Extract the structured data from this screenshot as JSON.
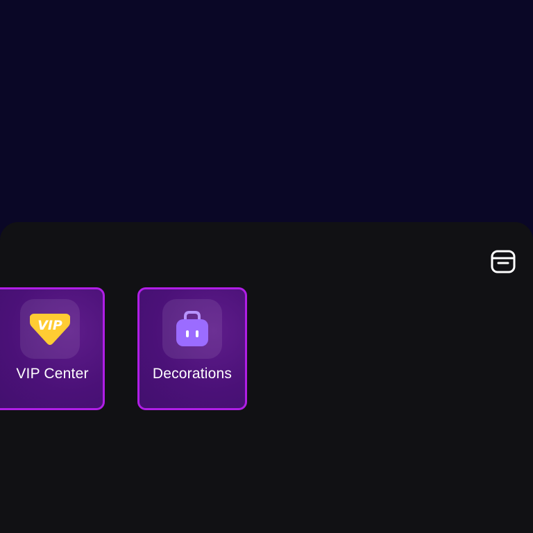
{
  "sheet": {
    "menu_icon": "archive-box-icon",
    "cards": [
      {
        "label": "VIP Center",
        "icon": "vip-diamond-icon",
        "icon_color": "#ffcc33"
      },
      {
        "label": "Decorations",
        "icon": "shopping-bag-icon",
        "icon_color": "#9b6cff"
      }
    ]
  },
  "colors": {
    "backdrop": "#0a0726",
    "sheet": "#111114",
    "card_border": "#b01ee6",
    "card_fill": "#4b1178"
  }
}
